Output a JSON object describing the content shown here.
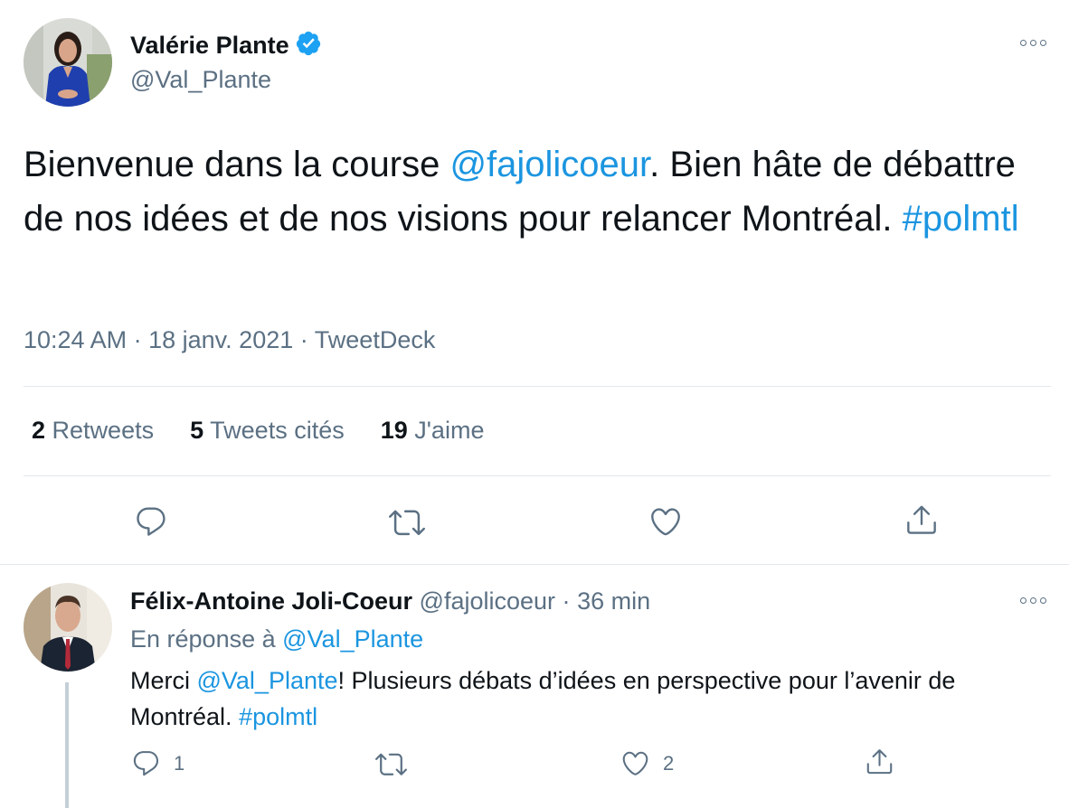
{
  "main_tweet": {
    "author_name": "Valérie Plante",
    "author_handle": "@Val_Plante",
    "text_segments": [
      {
        "text": "Bienvenue dans la course ",
        "type": "text"
      },
      {
        "text": "@fajolicoeur",
        "type": "mention"
      },
      {
        "text": ". Bien hâte de débattre de nos idées et de nos visions pour relancer Montréal. ",
        "type": "text"
      },
      {
        "text": "#polmtl",
        "type": "hashtag"
      }
    ],
    "time": "10:24 AM",
    "date": "18 janv. 2021",
    "client": "TweetDeck",
    "separator": "·",
    "stats": {
      "retweets_count": "2",
      "retweets_label": "Retweets",
      "quotes_count": "5",
      "quotes_label": "Tweets cités",
      "likes_count": "19",
      "likes_label": "J'aime"
    }
  },
  "reply": {
    "author_name": "Félix-Antoine Joli-Coeur",
    "author_handle": "@fajolicoeur",
    "time_ago": "36 min",
    "separator": "·",
    "replying_to_prefix": "En réponse à",
    "replying_to_handle": "@Val_Plante",
    "text_segments": [
      {
        "text": "Merci ",
        "type": "text"
      },
      {
        "text": "@Val_Plante",
        "type": "mention"
      },
      {
        "text": "! Plusieurs débats d’idées en perspective pour l’avenir de Montréal. ",
        "type": "text"
      },
      {
        "text": "#polmtl",
        "type": "hashtag"
      }
    ],
    "reply_count": "1",
    "retweet_count": "",
    "like_count": "2"
  },
  "icons": [
    "verified-badge-icon",
    "more-icon",
    "reply-icon",
    "retweet-icon",
    "like-icon",
    "share-icon"
  ],
  "colors": {
    "link": "#1b95e0",
    "muted": "#5b7083",
    "divider": "#e1e8ed",
    "verified": "#1da1f2"
  }
}
